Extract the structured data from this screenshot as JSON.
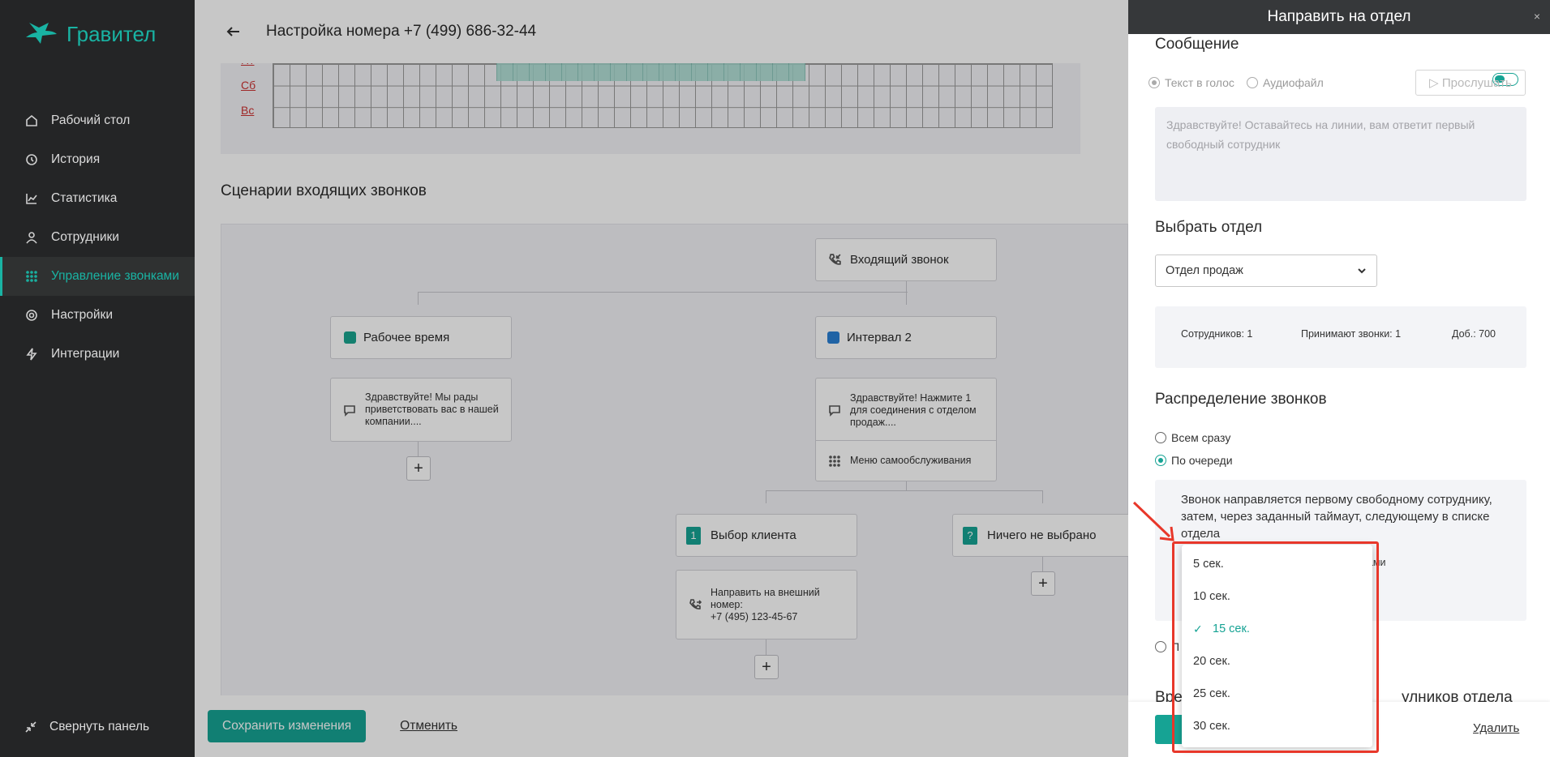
{
  "app": {
    "logo_text": "Гравител"
  },
  "sidebar": {
    "items": [
      {
        "label": "Рабочий стол",
        "icon": "home-icon"
      },
      {
        "label": "История",
        "icon": "history-icon"
      },
      {
        "label": "Статистика",
        "icon": "chart-icon"
      },
      {
        "label": "Сотрудники",
        "icon": "user-icon"
      },
      {
        "label": "Управление звонками",
        "icon": "dialpad-icon",
        "active": true
      },
      {
        "label": "Настройки",
        "icon": "gear-icon"
      },
      {
        "label": "Интеграции",
        "icon": "lightning-icon"
      }
    ],
    "collapse_label": "Свернуть панель"
  },
  "header": {
    "title": "Настройка номера +7 (499) 686-32-44"
  },
  "schedule": {
    "days": [
      "Пт",
      "Сб",
      "Вс"
    ]
  },
  "scenarios": {
    "title": "Сценарии входящих звонков",
    "incoming": "Входящий звонок",
    "work_time": "Рабочее время",
    "interval2": "Интервал 2",
    "work_msg": "Здравствуйте! Мы рады приветствовать вас в нашей компании....",
    "interval_msg": "Здравствуйте! Нажмите 1 для соединения с отделом продаж....",
    "self_service": "Меню самообслуживания",
    "choice1_num": "1",
    "choice1": "Выбор клиента",
    "choice2_num": "?",
    "choice2": "Ничего не выбрано",
    "forward_label": "Направить на внешний номер:",
    "forward_number": "+7 (495) 123-45-67",
    "plus": "+"
  },
  "footer": {
    "save": "Сохранить изменения",
    "cancel": "Отменить"
  },
  "drawer": {
    "title": "Направить на отдел",
    "close": "×",
    "message_title": "Сообщение",
    "tts": "Текст в голос",
    "audio": "Аудиофайл",
    "listen": "▷ Прослушать",
    "message_text": "Здравствуйте! Оставайтесь на линии, вам ответит первый свободный сотрудник",
    "dept_title": "Выбрать отдел",
    "dept_value": "Отдел продаж",
    "employees": "Сотрудников: 1",
    "accept_calls": "Принимают звонки: 1",
    "ext": "Доб.: 700",
    "distribution_title": "Распределение звонков",
    "all_at_once": "Всем сразу",
    "in_order": "По очереди",
    "description": "Звонок направляется первому свободному сотруднику, затем, через заданный таймаут, следующему в списке отдела",
    "partial_right": "одами",
    "partial_radio": "П",
    "partial_bottom_left": "Вре",
    "partial_bottom_right": "улников отдела",
    "delete": "Удалить"
  },
  "timeout_dropdown": {
    "options": [
      "5 сек.",
      "10 сек.",
      "15 сек.",
      "20 сек.",
      "25 сек.",
      "30 сек."
    ],
    "selected": "15 сек.",
    "check": "✓"
  },
  "colors": {
    "accent": "#16a394",
    "sidebar_bg": "#242526",
    "highlight": "#e8372a",
    "work_time_square": "#1aa58f",
    "interval_square": "#2a7fd4"
  }
}
